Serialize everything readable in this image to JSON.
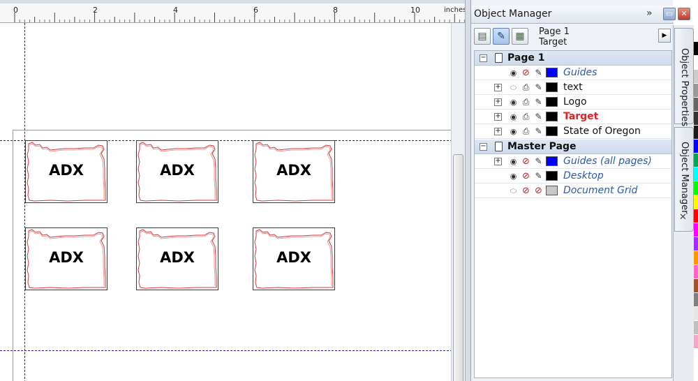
{
  "ruler": {
    "labels": [
      "0",
      "2",
      "4",
      "6",
      "8",
      "10"
    ],
    "units": "inches"
  },
  "badge": {
    "logo_text": "ADX",
    "count": 6
  },
  "docker": {
    "title": "Object Manager",
    "expand_symbol": "»",
    "page_info": {
      "page": "Page 1",
      "layer": "Target"
    },
    "tree": [
      {
        "type": "group",
        "label": "Page 1",
        "layers": [
          {
            "label": "Guides",
            "color": "#0000ff",
            "style": "italic",
            "expandable": false,
            "visible": true,
            "printable": false,
            "editable": true
          },
          {
            "label": "text",
            "color": "#000000",
            "style": "normal",
            "expandable": true,
            "visible": false,
            "printable": true,
            "editable": true
          },
          {
            "label": "Logo",
            "color": "#000000",
            "style": "normal",
            "expandable": true,
            "visible": true,
            "printable": true,
            "editable": true
          },
          {
            "label": "Target",
            "color": "#000000",
            "style": "active",
            "expandable": true,
            "visible": true,
            "printable": true,
            "editable": true
          },
          {
            "label": "State of Oregon",
            "color": "#000000",
            "style": "normal",
            "expandable": true,
            "visible": true,
            "printable": true,
            "editable": true
          }
        ]
      },
      {
        "type": "group",
        "label": "Master Page",
        "layers": [
          {
            "label": "Guides (all pages)",
            "color": "#0000ff",
            "style": "italic",
            "expandable": true,
            "visible": true,
            "printable": false,
            "editable": true
          },
          {
            "label": "Desktop",
            "color": "#000000",
            "style": "italic",
            "expandable": false,
            "visible": true,
            "printable": false,
            "editable": true
          },
          {
            "label": "Document Grid",
            "color": "#c8c8c8",
            "style": "italic",
            "expandable": false,
            "visible": false,
            "printable": false,
            "editable": false
          }
        ]
      }
    ]
  },
  "side_tabs": {
    "object_properties": "Object Properties",
    "object_manager": "Object Manager",
    "close_symbol": "✕"
  },
  "palette": {
    "colors": [
      "#000000",
      "#ffffff",
      "#cccccc",
      "#999999",
      "#666666",
      "#333333",
      "#1a1a1a",
      "#0000ff",
      "#00a651",
      "#00ffff",
      "#00ff00",
      "#ffff00",
      "#ff0000",
      "#ff00ff",
      "#9b30ff",
      "#ff9900",
      "#ff66cc",
      "#a0522d",
      "#808080",
      "#e6e6e6",
      "#c0c0c0",
      "#f4a6c6"
    ]
  }
}
